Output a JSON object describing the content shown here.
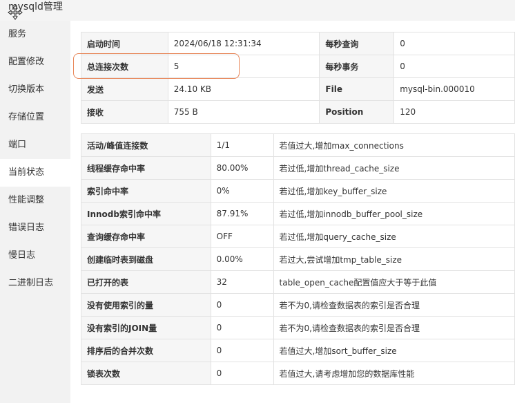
{
  "window": {
    "title": "mysqld管理"
  },
  "sidebar": {
    "items": [
      {
        "label": "服务"
      },
      {
        "label": "配置修改"
      },
      {
        "label": "切换版本"
      },
      {
        "label": "存储位置"
      },
      {
        "label": "端口"
      },
      {
        "label": "当前状态",
        "active": true
      },
      {
        "label": "性能调整"
      },
      {
        "label": "错误日志"
      },
      {
        "label": "慢日志"
      },
      {
        "label": "二进制日志"
      }
    ]
  },
  "status_table": {
    "rows": [
      {
        "k1": "启动时间",
        "v1": "2024/06/18 12:31:34",
        "k2": "每秒查询",
        "v2": "0"
      },
      {
        "k1": "总连接次数",
        "v1": "5",
        "k2": "每秒事务",
        "v2": "0"
      },
      {
        "k1": "发送",
        "v1": "24.10 KB",
        "k2": "File",
        "v2": "mysql-bin.000010"
      },
      {
        "k1": "接收",
        "v1": "755 B",
        "k2": "Position",
        "v2": "120"
      }
    ]
  },
  "perf_table": {
    "rows": [
      {
        "name": "活动/峰值连接数",
        "value": "1/1",
        "tip": "若值过大,增加max_connections"
      },
      {
        "name": "线程缓存命中率",
        "value": "80.00%",
        "tip": "若过低,增加thread_cache_size"
      },
      {
        "name": "索引命中率",
        "value": "0%",
        "tip": "若过低,增加key_buffer_size"
      },
      {
        "name": "Innodb索引命中率",
        "value": "87.91%",
        "tip": "若过低,增加innodb_buffer_pool_size"
      },
      {
        "name": "查询缓存命中率",
        "value": "OFF",
        "tip": "若过低,增加query_cache_size"
      },
      {
        "name": "创建临时表到磁盘",
        "value": "0.00%",
        "tip": "若过大,尝试增加tmp_table_size"
      },
      {
        "name": "已打开的表",
        "value": "32",
        "tip": "table_open_cache配置值应大于等于此值"
      },
      {
        "name": "没有使用索引的量",
        "value": "0",
        "tip": "若不为0,请检查数据表的索引是否合理"
      },
      {
        "name": "没有索引的JOIN量",
        "value": "0",
        "tip": "若不为0,请检查数据表的索引是否合理"
      },
      {
        "name": "排序后的合并次数",
        "value": "0",
        "tip": "若值过大,增加sort_buffer_size"
      },
      {
        "name": "锁表次数",
        "value": "0",
        "tip": "若值过大,请考虑增加您的数据库性能"
      }
    ]
  },
  "colors": {
    "highlight_border": "#e8875a",
    "sidebar_bg": "#f2f2f2",
    "key_cell_bg": "#f6f6f6"
  }
}
